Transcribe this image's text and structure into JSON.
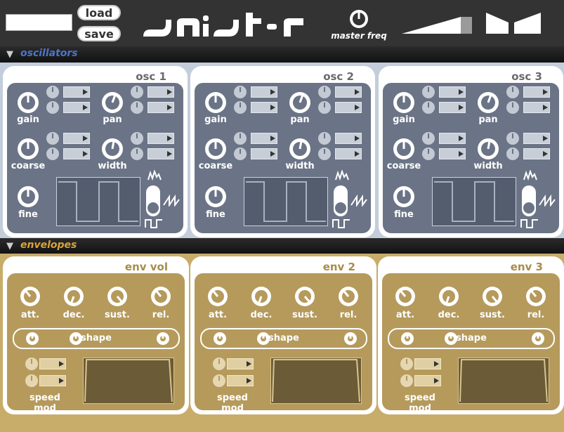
{
  "header": {
    "load_label": "load",
    "save_label": "save",
    "logo_text": "synister",
    "master_freq_label": "master freq"
  },
  "sections": {
    "oscillators": "oscillators",
    "envelopes": "envelopes"
  },
  "oscillators": [
    {
      "title": "osc 1",
      "gain": "gain",
      "pan": "pan",
      "coarse": "coarse",
      "width": "width",
      "fine": "fine"
    },
    {
      "title": "osc 2",
      "gain": "gain",
      "pan": "pan",
      "coarse": "coarse",
      "width": "width",
      "fine": "fine"
    },
    {
      "title": "osc 3",
      "gain": "gain",
      "pan": "pan",
      "coarse": "coarse",
      "width": "width",
      "fine": "fine"
    }
  ],
  "envelopes": [
    {
      "title": "env vol",
      "att": "att.",
      "dec": "dec.",
      "sust": "sust.",
      "rel": "rel.",
      "shape": "shape",
      "speed_mod": "speed mod"
    },
    {
      "title": "env 2",
      "att": "att.",
      "dec": "dec.",
      "sust": "sust.",
      "rel": "rel.",
      "shape": "shape",
      "speed_mod": "speed mod"
    },
    {
      "title": "env 3",
      "att": "att.",
      "dec": "dec.",
      "sust": "sust.",
      "rel": "rel.",
      "shape": "shape",
      "speed_mod": "speed mod"
    }
  ],
  "colors": {
    "topbar": "#333333",
    "osc_panel": "#6b7486",
    "osc_bg": "#c3cddb",
    "env_panel": "#b59a5c",
    "env_bg": "#c8ac6a",
    "osc_section_title": "#4d74c9",
    "env_section_title": "#d9a43a"
  },
  "icons": {
    "volume": "volume-ramp-icon",
    "filter": "filter-shape-icon",
    "noise": "noise-wave-icon",
    "saw": "saw-wave-icon",
    "square": "square-wave-icon"
  }
}
